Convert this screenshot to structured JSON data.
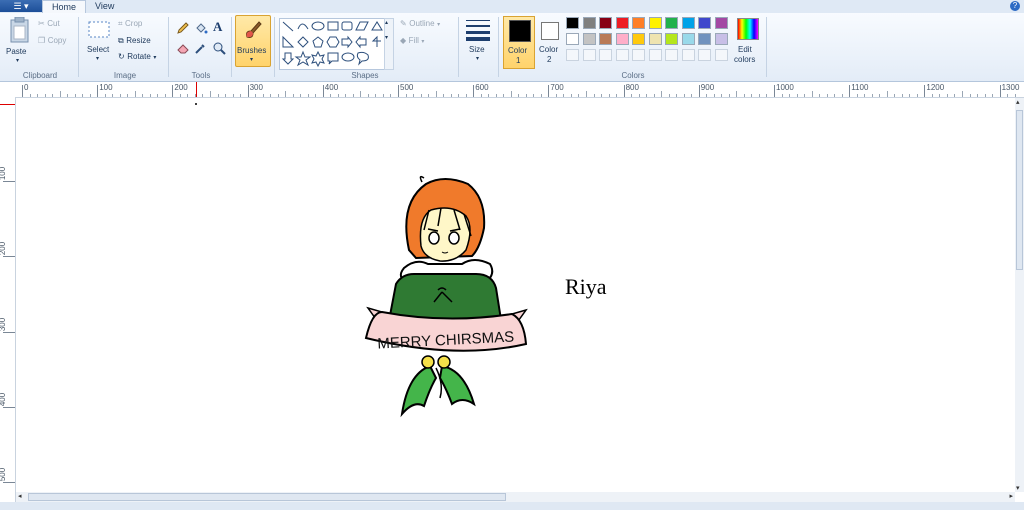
{
  "app_menu": {
    "label": "☰ ▾"
  },
  "tabs": [
    {
      "label": "Home"
    },
    {
      "label": "View"
    }
  ],
  "help_label": "?",
  "clipboard": {
    "paste": "Paste",
    "cut": "Cut",
    "copy": "Copy",
    "group": "Clipboard"
  },
  "image": {
    "select": "Select",
    "crop": "Crop",
    "resize": "Resize",
    "rotate": "Rotate",
    "group": "Image"
  },
  "tools": {
    "group": "Tools",
    "text_glyph": "A"
  },
  "brushes": {
    "label": "Brushes"
  },
  "shapes": {
    "group": "Shapes",
    "outline": "Outline",
    "fill": "Fill"
  },
  "size": {
    "label": "Size"
  },
  "color1": {
    "label": "Color",
    "index": "1",
    "value": "#000000"
  },
  "color2": {
    "label": "Color",
    "index": "2",
    "value": "#ffffff"
  },
  "colors": {
    "group": "Colors",
    "row1": [
      "#000000",
      "#7f7f7f",
      "#880015",
      "#ed1c24",
      "#ff7f27",
      "#fff200",
      "#22b14c",
      "#00a2e8",
      "#3f48cc",
      "#a349a4"
    ],
    "row2": [
      "#ffffff",
      "#c3c3c3",
      "#b97a57",
      "#ffaec9",
      "#ffc90e",
      "#efe4b0",
      "#b5e61d",
      "#99d9ea",
      "#7092be",
      "#c8bfe7"
    ]
  },
  "edit_colors": {
    "line1": "Edit",
    "line2": "colors"
  },
  "ruler": {
    "top": [
      "0",
      "100",
      "200",
      "300",
      "400",
      "500",
      "600",
      "700",
      "800",
      "900",
      "1000",
      "1100",
      "1200",
      "1300"
    ],
    "left": [
      "100",
      "200",
      "300",
      "400",
      "500"
    ]
  },
  "drawing": {
    "banner_text": "MERRY CHIRSMAS",
    "signature": "Riya"
  }
}
